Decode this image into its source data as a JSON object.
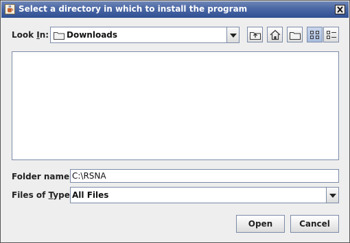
{
  "window": {
    "title": "Select a directory in which to install the program"
  },
  "look_in": {
    "label_prefix": "Look ",
    "label_mnemonic": "I",
    "label_suffix": "n:",
    "selected": "Downloads"
  },
  "folder_name": {
    "label": "Folder name:",
    "value": "C:\\RSNA"
  },
  "files_of_type": {
    "label_prefix": "Files of ",
    "label_mnemonic": "T",
    "label_suffix": "ype:",
    "selected": "All Files"
  },
  "buttons": {
    "open": "Open",
    "cancel": "Cancel"
  },
  "icons": {
    "title": "java-cup-icon",
    "close": "close-icon",
    "folder": "folder-icon",
    "up_one_level": "up-folder-icon",
    "home": "home-icon",
    "new_folder": "new-folder-icon",
    "list_view": "list-view-icon",
    "details_view": "details-view-icon"
  },
  "colors": {
    "titlebar": "#3d5a9a",
    "dialog_bg": "#eeeeee",
    "border": "#7a8aa8"
  }
}
